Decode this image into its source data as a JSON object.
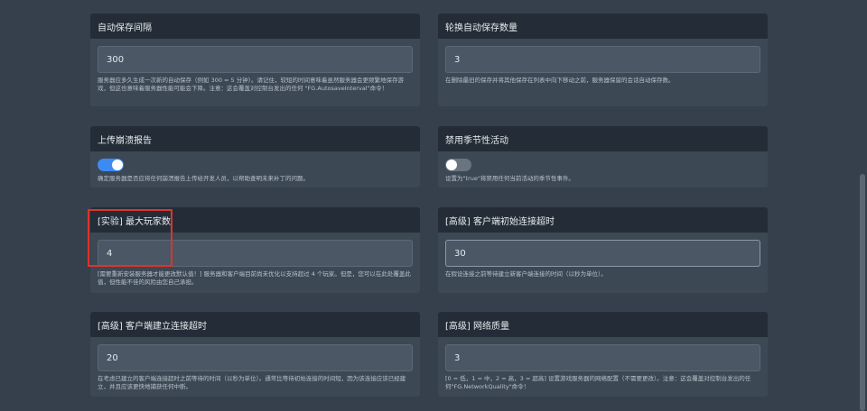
{
  "settings": {
    "autosave_interval": {
      "title": "自动保存间隔",
      "value": "300",
      "description": "服务器应多久生成一次新的自动保存（例如 300 = 5 分钟）。请记住，较短的时间意味着虽然服务器会更频繁地保存游戏，但这也意味着服务器性能可能会下降。注意：这会覆盖对控制台发出的任何 \"FG.AutosaveInterval\"命令！"
    },
    "autosave_rotation": {
      "title": "轮换自动保存数量",
      "value": "3",
      "description": "在删除最旧的保存并将其他保存在列表中向下移动之前，服务器保留的会话自动保存数。"
    },
    "upload_crash_reports": {
      "title": "上传崩溃报告",
      "enabled": true,
      "description": "确定服务器是否应将任何崩溃报告上传给开发人员，以帮助查明未来补丁的问题。"
    },
    "disable_seasonal_events": {
      "title": "禁用季节性活动",
      "enabled": false,
      "description": "设置为\"true\"将禁用任何当前活动的季节性事件。"
    },
    "max_players": {
      "title": "[实验] 最大玩家数",
      "value": "4",
      "description": "[需要重新安装服务器才能更改默认值！] 服务器和客户端目前尚未优化以支持超过 4 个玩家。但是，您可以在此处覆盖此值，但性能不佳的风险由您自己承担。"
    },
    "client_initial_timeout": {
      "title": "[高级] 客户端初始连接超时",
      "value": "30",
      "description": "在假设连接之前等待建立新客户端连接的时间（以秒为单位）。"
    },
    "client_connection_timeout": {
      "title": "[高级] 客户端建立连接超时",
      "value": "20",
      "description": "在考虑已建立的客户端连接超时之前等待的时间（以秒为单位）。通常比等待初始连接的时间短，因为该连接应该已经建立，并且应该更快地捕获任何中断。"
    },
    "network_quality": {
      "title": "[高级] 网络质量",
      "value": "3",
      "description": "[0 = 低，1 = 中，2 = 高，3 = 超高] 设置游戏服务器的网络配置（不需要更改）。注意：这会覆盖对控制台发出的任何\"FG.NetworkQuality\"命令！"
    }
  },
  "colors": {
    "toggle_on": "#3d8bf2",
    "toggle_off": "#6b7580",
    "highlight": "#e0332b"
  }
}
